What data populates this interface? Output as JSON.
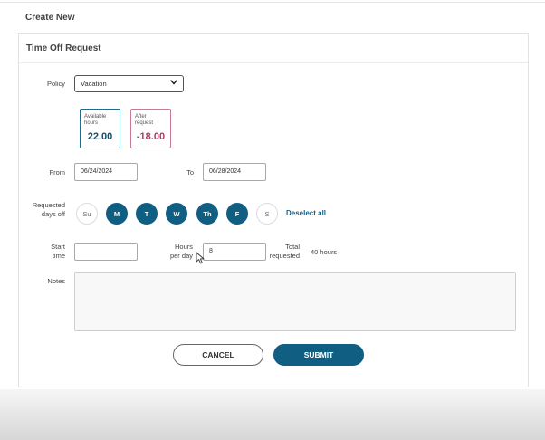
{
  "page": {
    "title": "Create New"
  },
  "form": {
    "title": "Time Off Request",
    "policy": {
      "label": "Policy",
      "value": "Vacation",
      "icon": "chevron-down-icon"
    },
    "available": {
      "label_line1": "Available",
      "label_line2": "hours",
      "value": "22.00"
    },
    "after": {
      "label_line1": "After",
      "label_line2": "request",
      "value": "-18.00"
    },
    "from": {
      "label": "From",
      "value": "06/24/2024"
    },
    "to": {
      "label": "To",
      "value": "06/28/2024"
    },
    "requested_days": {
      "label_line1": "Requested",
      "label_line2": "days off",
      "days": [
        {
          "label": "Su",
          "selected": false
        },
        {
          "label": "M",
          "selected": true
        },
        {
          "label": "T",
          "selected": true
        },
        {
          "label": "W",
          "selected": true
        },
        {
          "label": "Th",
          "selected": true
        },
        {
          "label": "F",
          "selected": true
        },
        {
          "label": "S",
          "selected": false
        }
      ],
      "deselect_label": "Deselect all"
    },
    "start_time": {
      "label_line1": "Start",
      "label_line2": "time",
      "value": ""
    },
    "hours_per_day": {
      "label_line1": "Hours",
      "label_line2": "per day",
      "value": "8"
    },
    "total": {
      "label_line1": "Total",
      "label_line2": "requested",
      "value": "40 hours"
    },
    "notes": {
      "label": "Notes",
      "value": ""
    },
    "actions": {
      "cancel_label": "CANCEL",
      "submit_label": "SUBMIT"
    }
  },
  "colors": {
    "primary": "#115e83",
    "positive": "#134f6e",
    "negative": "#b33a5e"
  }
}
